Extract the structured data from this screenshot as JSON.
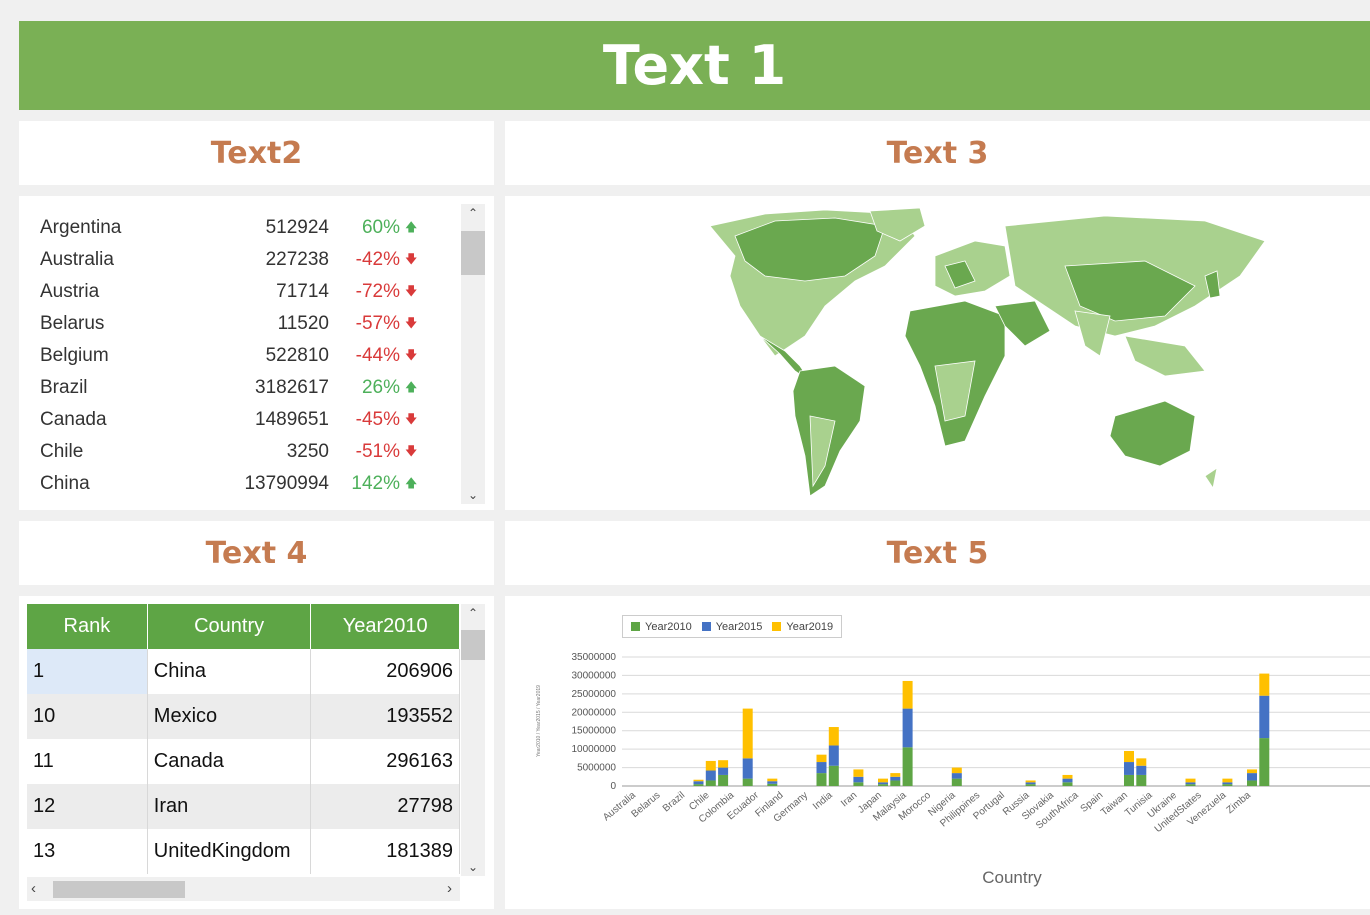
{
  "header": {
    "title": "Text 1"
  },
  "panels": {
    "list_title": "Text2",
    "map_title": "Text 3",
    "table_title": "Text 4",
    "chart_title": "Text 5"
  },
  "list": [
    {
      "country": "Argentina",
      "value": "512924",
      "pct": "60%",
      "dir": "up"
    },
    {
      "country": "Australia",
      "value": "227238",
      "pct": "-42%",
      "dir": "down"
    },
    {
      "country": "Austria",
      "value": "71714",
      "pct": "-72%",
      "dir": "down"
    },
    {
      "country": "Belarus",
      "value": "11520",
      "pct": "-57%",
      "dir": "down"
    },
    {
      "country": "Belgium",
      "value": "522810",
      "pct": "-44%",
      "dir": "down"
    },
    {
      "country": "Brazil",
      "value": "3182617",
      "pct": "26%",
      "dir": "up"
    },
    {
      "country": "Canada",
      "value": "1489651",
      "pct": "-45%",
      "dir": "down"
    },
    {
      "country": "Chile",
      "value": "3250",
      "pct": "-51%",
      "dir": "down"
    },
    {
      "country": "China",
      "value": "13790994",
      "pct": "142%",
      "dir": "up"
    }
  ],
  "table": {
    "headers": [
      "Rank",
      "Country",
      "Year2010"
    ],
    "rows": [
      [
        "1",
        "China",
        "206906"
      ],
      [
        "10",
        "Mexico",
        "193552"
      ],
      [
        "11",
        "Canada",
        "296163"
      ],
      [
        "12",
        "Iran",
        "27798"
      ],
      [
        "13",
        "UnitedKingdom",
        "181389"
      ]
    ]
  },
  "icons": {
    "up": "arrow-up-icon",
    "down": "arrow-down-icon",
    "scroll_up": "chevron-up-icon",
    "scroll_down": "chevron-down-icon",
    "scroll_left": "chevron-left-icon",
    "scroll_right": "chevron-right-icon"
  },
  "colors": {
    "banner": "#7ab055",
    "title": "#c57b50",
    "up": "#4db05a",
    "down": "#d93a3a",
    "map_dark": "#6aa84f",
    "map_light": "#a9d18e"
  },
  "chart_data": {
    "type": "bar",
    "stacked": true,
    "xlabel": "Country",
    "ylabel": "Year2010 / Year2015 / Year2019",
    "ylim": [
      0,
      35000000
    ],
    "yticks": [
      "35000000",
      "30000000",
      "25000000",
      "20000000",
      "15000000",
      "10000000",
      "5000000",
      "0"
    ],
    "legend_position": "top-left",
    "categories": [
      "Australia",
      "Belarus",
      "Brazil",
      "Chile",
      "Colombia",
      "Ecuador",
      "Finland",
      "Germany",
      "India",
      "Iran",
      "Japan",
      "Malaysia",
      "Morocco",
      "Nigeria",
      "Philippines",
      "Portugal",
      "Russia",
      "Slovakia",
      "SouthAfrica",
      "Spain",
      "Taiwan",
      "Tunisia",
      "Ukraine",
      "UnitedStates",
      "Venezuela",
      "Zimba"
    ],
    "tick_labels": [
      "Australia",
      "Belarus",
      "Brazil",
      "Chile",
      "Colombia",
      "Ecuador",
      "Finland",
      "Germany",
      "India",
      "Iran",
      "Japan",
      "Malaysia",
      "Morocco",
      "Nigeria",
      "Philippines",
      "Portugal",
      "Russia",
      "Slovakia",
      "SouthAfrica",
      "Spain",
      "Taiwan",
      "Tunisia",
      "Ukraine",
      "UnitedStates",
      "Venezuela",
      "Zimba"
    ],
    "bars": [
      {
        "slot": 5,
        "values": [
          500000,
          800000,
          400000
        ]
      },
      {
        "slot": 6,
        "values": [
          1500000,
          2700000,
          2600000
        ]
      },
      {
        "slot": 7,
        "values": [
          3000000,
          2000000,
          2000000
        ]
      },
      {
        "slot": 9,
        "values": [
          2000000,
          5500000,
          13500000
        ]
      },
      {
        "slot": 11,
        "values": [
          600000,
          700000,
          700000
        ]
      },
      {
        "slot": 15,
        "values": [
          3500000,
          3000000,
          2000000
        ]
      },
      {
        "slot": 16,
        "values": [
          5500000,
          5500000,
          5000000
        ]
      },
      {
        "slot": 18,
        "values": [
          1000000,
          1500000,
          2000000
        ]
      },
      {
        "slot": 20,
        "values": [
          500000,
          500000,
          1000000
        ]
      },
      {
        "slot": 21,
        "values": [
          1500000,
          1000000,
          1000000
        ]
      },
      {
        "slot": 22,
        "values": [
          10500000,
          10500000,
          7500000
        ]
      },
      {
        "slot": 26,
        "values": [
          2000000,
          1500000,
          1500000
        ]
      },
      {
        "slot": 32,
        "values": [
          500000,
          500000,
          500000
        ]
      },
      {
        "slot": 35,
        "values": [
          1000000,
          1000000,
          1000000
        ]
      },
      {
        "slot": 40,
        "values": [
          3000000,
          3500000,
          3000000
        ]
      },
      {
        "slot": 41,
        "values": [
          3000000,
          2500000,
          2000000
        ]
      },
      {
        "slot": 45,
        "values": [
          500000,
          500000,
          1000000
        ]
      },
      {
        "slot": 48,
        "values": [
          500000,
          500000,
          1000000
        ]
      },
      {
        "slot": 50,
        "values": [
          1500000,
          2000000,
          1000000
        ]
      },
      {
        "slot": 51,
        "values": [
          13000000,
          11500000,
          6000000
        ]
      }
    ],
    "series": [
      {
        "name": "Year2010",
        "color": "#5ea545"
      },
      {
        "name": "Year2015",
        "color": "#4472c4"
      },
      {
        "name": "Year2019",
        "color": "#ffc000"
      }
    ]
  }
}
